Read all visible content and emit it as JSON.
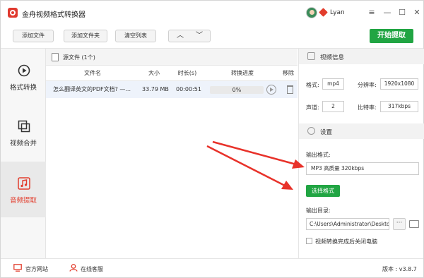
{
  "app": {
    "title": "金舟视频格式转换器",
    "username": "Lyan",
    "window_buttons": {
      "menu": "≡",
      "minimize": "—",
      "maximize": "☐",
      "close": "✕"
    }
  },
  "toolbar": {
    "add_file": "添加文件",
    "add_folder": "添加文件夹",
    "clear_list": "清空列表",
    "move_up": "︿",
    "move_down": "﹀",
    "start": "开始提取"
  },
  "sidebar": {
    "items": [
      {
        "label": "格式转换",
        "icon": "play-circle-icon",
        "active": false
      },
      {
        "label": "视频合并",
        "icon": "merge-icon",
        "active": false
      },
      {
        "label": "音频提取",
        "icon": "music-note-icon",
        "active": true
      }
    ]
  },
  "filelist": {
    "title": "源文件 (1个)",
    "columns": [
      "文件名",
      "大小",
      "时长(s)",
      "转换进度",
      "移除"
    ],
    "rows": [
      {
        "name": "怎么翻译英文的PDF文档? —...",
        "size": "33.79 MB",
        "duration": "00:00:51",
        "progress": "0%"
      }
    ]
  },
  "video_info": {
    "title": "视频信息",
    "format_label": "格式:",
    "format": "mp4",
    "resolution_label": "分辨率:",
    "resolution": "1920x1080",
    "channels_label": "声道:",
    "channels": "2",
    "bitrate_label": "比特率:",
    "bitrate": "317kbps"
  },
  "settings": {
    "title": "设置",
    "output_format_label": "输出格式:",
    "output_format": "MP3 高质量 320kbps",
    "choose_format": "选择格式",
    "output_dir_label": "输出目录:",
    "output_dir": "C:\\Users\\Administrator\\Deskto",
    "browse": "···",
    "shutdown_label": "视频转换完成后关闭电脑",
    "shutdown_checked": false
  },
  "statusbar": {
    "website": "官方网站",
    "support": "在线客服",
    "version": "版本 : v3.8.7"
  },
  "colors": {
    "accent_green": "#21a543",
    "accent_red": "#e23d2d",
    "annotation_arrow": "#e8322a"
  }
}
